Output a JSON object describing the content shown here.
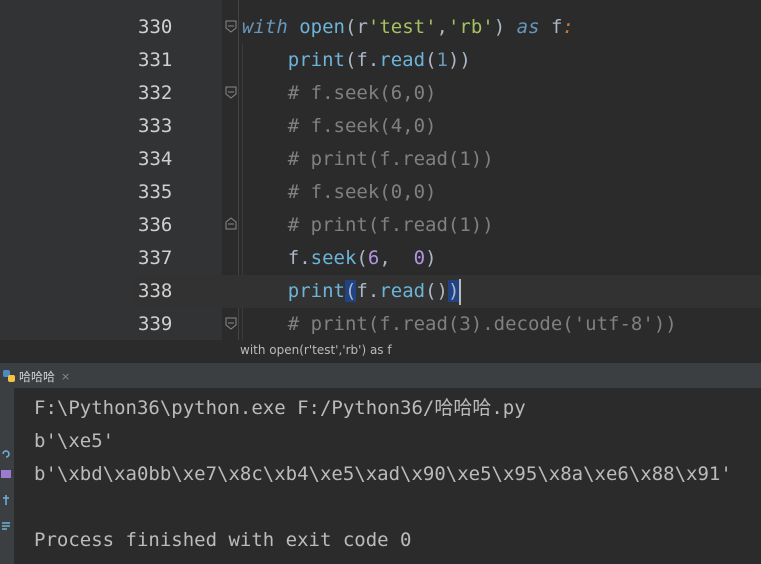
{
  "editor": {
    "lines": [
      {
        "n": "330",
        "parts": [
          [
            "kw2",
            "with"
          ],
          [
            "dim",
            " "
          ],
          [
            "bi",
            "open"
          ],
          [
            "dim",
            "("
          ],
          [
            "dim",
            "r"
          ],
          [
            "str",
            "'test'"
          ],
          [
            "dim",
            ","
          ],
          [
            "str",
            "'rb'"
          ],
          [
            "dim",
            ") "
          ],
          [
            "kw2",
            "as"
          ],
          [
            "dim",
            " f"
          ],
          [
            "kw",
            ":"
          ]
        ],
        "fold": "open"
      },
      {
        "n": "331",
        "parts": [
          [
            "dim",
            "    "
          ],
          [
            "bi",
            "print"
          ],
          [
            "dim",
            "(f."
          ],
          [
            "bi",
            "read"
          ],
          [
            "dim",
            "("
          ],
          [
            "num",
            "1"
          ],
          [
            "dim",
            "))"
          ]
        ]
      },
      {
        "n": "332",
        "parts": [
          [
            "dim",
            "    "
          ],
          [
            "cm",
            "# f.seek(6,0)"
          ]
        ],
        "fold": "open"
      },
      {
        "n": "333",
        "parts": [
          [
            "dim",
            "    "
          ],
          [
            "cm",
            "# f.seek(4,0)"
          ]
        ]
      },
      {
        "n": "334",
        "parts": [
          [
            "dim",
            "    "
          ],
          [
            "cm",
            "# print(f.read(1))"
          ]
        ]
      },
      {
        "n": "335",
        "parts": [
          [
            "dim",
            "    "
          ],
          [
            "cm",
            "# f.seek(0,0)"
          ]
        ]
      },
      {
        "n": "336",
        "parts": [
          [
            "dim",
            "    "
          ],
          [
            "cm",
            "# print(f.read(1))"
          ]
        ],
        "fold": "end"
      },
      {
        "n": "337",
        "parts": [
          [
            "dim",
            "    f."
          ],
          [
            "bi",
            "seek"
          ],
          [
            "dim",
            "("
          ],
          [
            "num2",
            "6"
          ],
          [
            "dim",
            ",  "
          ],
          [
            "num2",
            "0"
          ],
          [
            "dim",
            ")"
          ]
        ]
      },
      {
        "n": "338",
        "parts": [
          [
            "dim",
            "    "
          ],
          [
            "bi",
            "print"
          ],
          [
            "sel",
            "("
          ],
          [
            "dim",
            "f."
          ],
          [
            "bi",
            "read"
          ],
          [
            "dim",
            "()"
          ],
          [
            "sel",
            ")"
          ]
        ],
        "current": true
      },
      {
        "n": "339",
        "parts": [
          [
            "dim",
            "    "
          ],
          [
            "cm",
            "# print(f.read(3).decode('utf-8'))"
          ]
        ],
        "fold": "open"
      }
    ],
    "breadcrumb": "with open(r'test','rb') as f"
  },
  "run": {
    "tab_label": "哈哈哈",
    "close": "×",
    "output": [
      "F:\\Python36\\python.exe F:/Python36/哈哈哈.py",
      "b'\\xe5'",
      "b'\\xbd\\xa0bb\\xe7\\x8c\\xb4\\xe5\\xad\\x90\\xe5\\x95\\x8a\\xe6\\x88\\x91'",
      "",
      "Process finished with exit code 0"
    ]
  },
  "colors": {
    "accent": "#214283",
    "comment": "#808080",
    "builtin": "#6cb4d9"
  }
}
